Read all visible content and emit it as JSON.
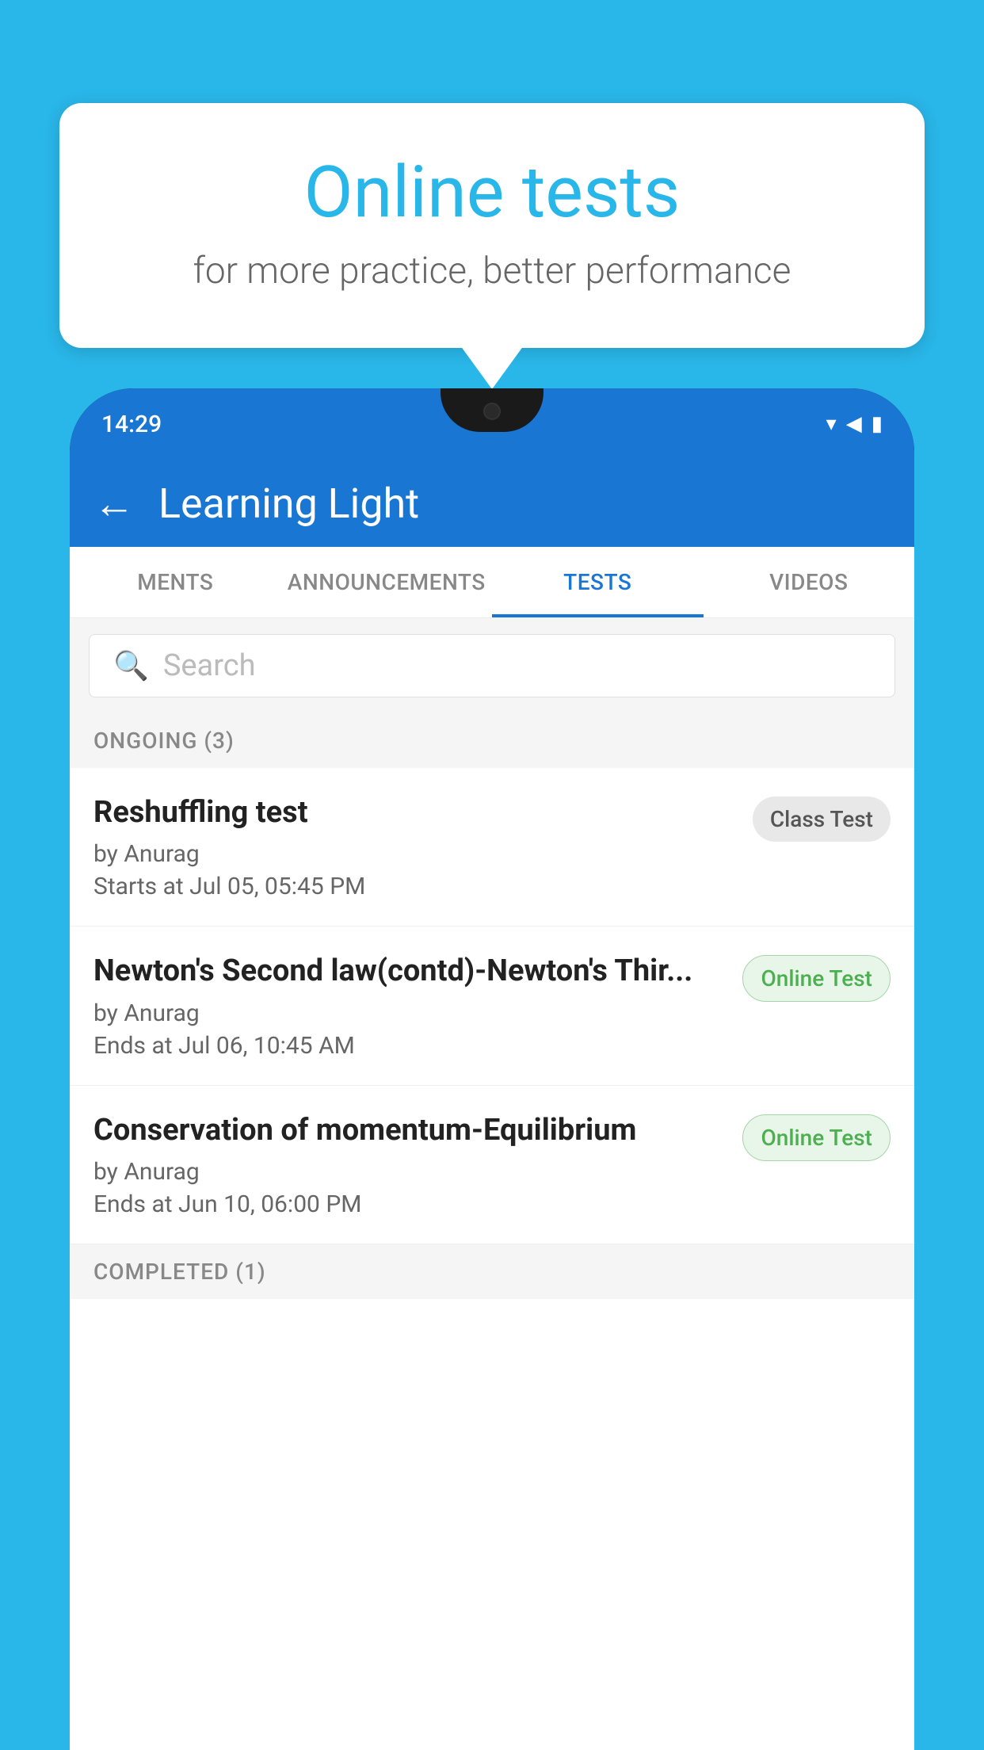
{
  "background_color": "#29B6E8",
  "bubble": {
    "title": "Online tests",
    "subtitle": "for more practice, better performance"
  },
  "status_bar": {
    "time": "14:29",
    "icons": [
      "wifi",
      "signal",
      "battery"
    ]
  },
  "app_header": {
    "title": "Learning Light",
    "back_label": "←"
  },
  "tabs": [
    {
      "label": "MENTS",
      "active": false
    },
    {
      "label": "ANNOUNCEMENTS",
      "active": false
    },
    {
      "label": "TESTS",
      "active": true
    },
    {
      "label": "VIDEOS",
      "active": false
    }
  ],
  "search": {
    "placeholder": "Search"
  },
  "section_ongoing": {
    "label": "ONGOING (3)"
  },
  "tests": [
    {
      "title": "Reshuffling test",
      "author": "by Anurag",
      "time": "Starts at  Jul 05, 05:45 PM",
      "badge": "Class Test",
      "badge_type": "class"
    },
    {
      "title": "Newton's Second law(contd)-Newton's Thir...",
      "author": "by Anurag",
      "time": "Ends at  Jul 06, 10:45 AM",
      "badge": "Online Test",
      "badge_type": "online"
    },
    {
      "title": "Conservation of momentum-Equilibrium",
      "author": "by Anurag",
      "time": "Ends at  Jun 10, 06:00 PM",
      "badge": "Online Test",
      "badge_type": "online"
    }
  ],
  "section_completed": {
    "label": "COMPLETED (1)"
  }
}
